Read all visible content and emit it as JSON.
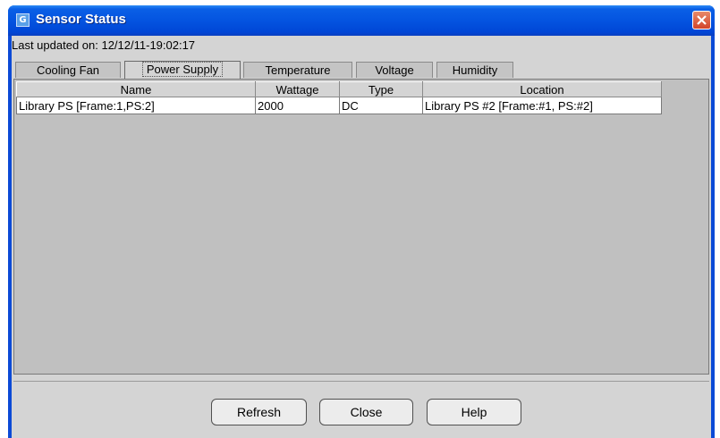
{
  "window": {
    "title": "Sensor Status",
    "app_icon": "app-icon",
    "close_icon": "close-icon"
  },
  "status": {
    "last_updated": "Last updated on: 12/12/11-19:02:17"
  },
  "tabs": [
    {
      "label": "Cooling Fan",
      "active": false
    },
    {
      "label": "Power Supply",
      "active": true
    },
    {
      "label": "Temperature",
      "active": false
    },
    {
      "label": "Voltage",
      "active": false
    },
    {
      "label": "Humidity",
      "active": false
    }
  ],
  "table": {
    "columns": [
      "Name",
      "Wattage",
      "Type",
      "Location"
    ],
    "rows": [
      [
        "Library PS [Frame:1,PS:2]",
        "2000",
        "DC",
        "Library PS #2 [Frame:#1, PS:#2]"
      ]
    ]
  },
  "buttons": {
    "refresh": "Refresh",
    "close": "Close",
    "help": "Help"
  },
  "colors": {
    "title_bar": "#0454e0",
    "close_button": "#d2442a",
    "dialog_bg": "#d4d4d4"
  }
}
